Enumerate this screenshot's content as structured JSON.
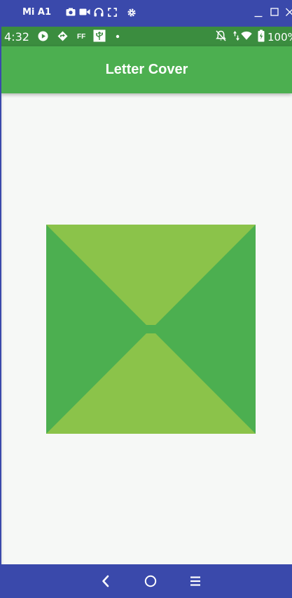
{
  "window": {
    "device_name": "Mi A1",
    "icons": [
      "camera-icon",
      "video-icon",
      "headphones-icon",
      "fullscreen-icon",
      "settings-icon",
      "minimize-icon",
      "maximize-icon",
      "close-icon"
    ]
  },
  "status_bar": {
    "time": "4:32",
    "left_icons": [
      "play-icon",
      "nav-app-icon",
      "ff-icon",
      "usb-icon",
      "dot-icon"
    ],
    "right_icons": [
      "bell-off-icon",
      "data-arrows-icon",
      "wifi-icon",
      "battery-charging-icon"
    ],
    "battery": "100%"
  },
  "app_bar": {
    "title": "Letter Cover"
  },
  "cover": {
    "colors": {
      "side_flaps": "#4caf50",
      "top_bottom_flaps": "#8bc34a"
    }
  },
  "nav_bar": {
    "icons": [
      "back-icon",
      "home-icon",
      "menu-icon"
    ]
  },
  "colors": {
    "window_bar": "#3a49ab",
    "status_bar": "#3b8d3f",
    "app_bar": "#4caf50",
    "background": "#f6f8f6"
  }
}
